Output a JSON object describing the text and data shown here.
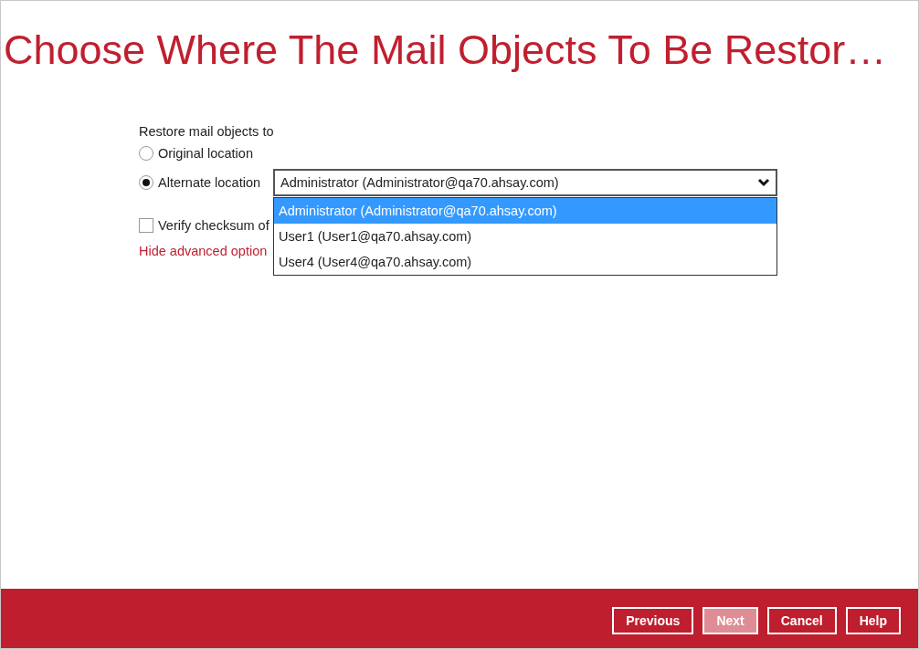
{
  "title": "Choose Where The Mail Objects To Be Restor…",
  "restore_to": {
    "label": "Restore mail objects to",
    "options": [
      {
        "label": "Original location",
        "selected": false
      },
      {
        "label": "Alternate location",
        "selected": true
      }
    ]
  },
  "destination_dropdown": {
    "value": "Administrator (Administrator@qa70.ahsay.com)",
    "expanded": true,
    "items": [
      {
        "label": "Administrator (Administrator@qa70.ahsay.com)",
        "selected": true
      },
      {
        "label": "User1 (User1@qa70.ahsay.com)",
        "selected": false
      },
      {
        "label": "User4 (User4@qa70.ahsay.com)",
        "selected": false
      }
    ]
  },
  "verify_checksum": {
    "label": "Verify checksum of",
    "checked": false
  },
  "advanced_link": "Hide advanced option",
  "buttons": [
    {
      "label": "Previous",
      "disabled": false
    },
    {
      "label": "Next",
      "disabled": true
    },
    {
      "label": "Cancel",
      "disabled": false
    },
    {
      "label": "Help",
      "disabled": false
    }
  ]
}
